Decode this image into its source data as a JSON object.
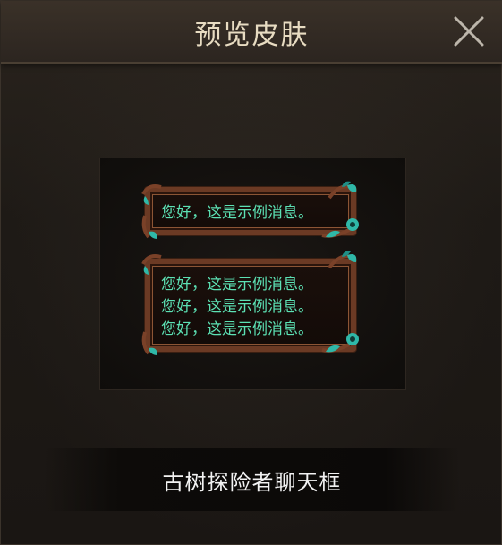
{
  "dialog": {
    "title": "预览皮肤",
    "close_icon": "close-icon"
  },
  "preview": {
    "single_message": {
      "lines": [
        "您好，这是示例消息。"
      ]
    },
    "multi_message": {
      "lines": [
        "您好，这是示例消息。",
        "您好，这是示例消息。",
        "您好，这是示例消息。"
      ]
    }
  },
  "skin": {
    "name": "古树探险者聊天框"
  },
  "colors": {
    "title_text": "#e8dcc2",
    "message_text": "#5ce1b4",
    "frame_wood": "#6b3a24",
    "leaf_teal": "#2fb8a8"
  }
}
